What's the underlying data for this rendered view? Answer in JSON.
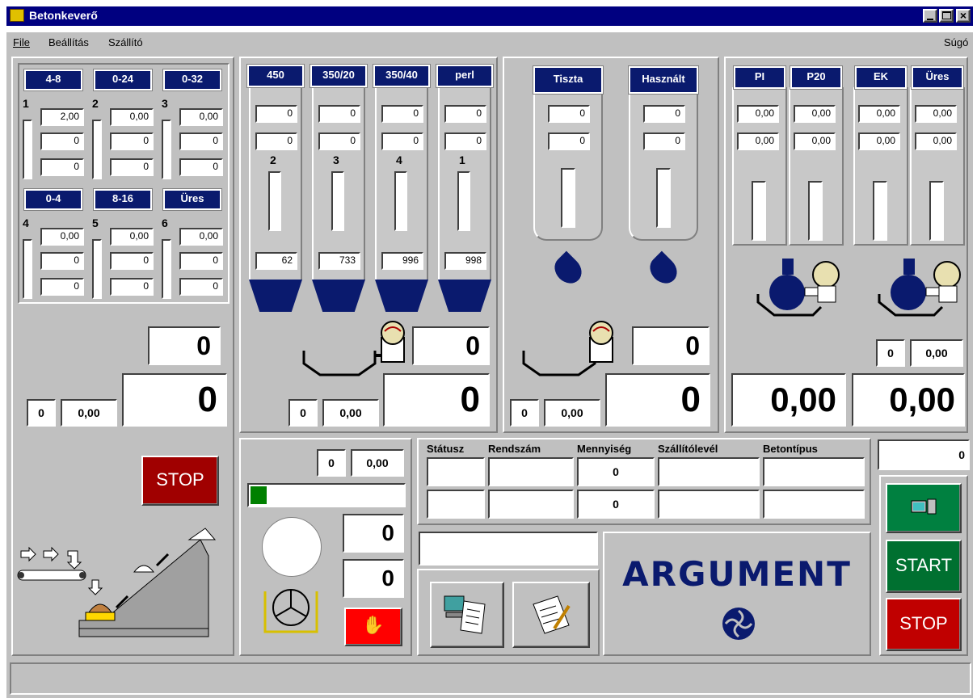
{
  "window": {
    "title": "Betonkeverő"
  },
  "menu": {
    "file": "File",
    "settings": "Beállítás",
    "supplier": "Szállító",
    "help": "Súgó"
  },
  "aggregates": [
    {
      "name": "4-8",
      "num": "1",
      "v1": "2,00",
      "v2": "0",
      "v3": "0"
    },
    {
      "name": "0-24",
      "num": "2",
      "v1": "0,00",
      "v2": "0",
      "v3": "0"
    },
    {
      "name": "0-32",
      "num": "3",
      "v1": "0,00",
      "v2": "0",
      "v3": "0"
    },
    {
      "name": "0-4",
      "num": "4",
      "v1": "0,00",
      "v2": "0",
      "v3": "0"
    },
    {
      "name": "8-16",
      "num": "5",
      "v1": "0,00",
      "v2": "0",
      "v3": "0"
    },
    {
      "name": "Üres",
      "num": "6",
      "v1": "0,00",
      "v2": "0",
      "v3": "0"
    }
  ],
  "agg_panel": {
    "scale": "0",
    "total": "0",
    "small_count": "0",
    "small_val": "0,00",
    "stop": "STOP"
  },
  "cement": [
    {
      "name": "450",
      "v1": "0",
      "v2": "0",
      "num": "2",
      "level": "62"
    },
    {
      "name": "350/20",
      "v1": "0",
      "v2": "0",
      "num": "3",
      "level": "733"
    },
    {
      "name": "350/40",
      "v1": "0",
      "v2": "0",
      "num": "4",
      "level": "996"
    },
    {
      "name": "perl",
      "v1": "0",
      "v2": "0",
      "num": "1",
      "level": "998"
    }
  ],
  "cement_panel": {
    "scale": "0",
    "total": "0",
    "small_count": "0",
    "small_val": "0,00"
  },
  "water": [
    {
      "name": "Tiszta",
      "v1": "0",
      "v2": "0"
    },
    {
      "name": "Használt",
      "v1": "0",
      "v2": "0"
    }
  ],
  "water_panel": {
    "scale": "0",
    "total": "0",
    "small_count": "0",
    "small_val": "0,00"
  },
  "additives": [
    {
      "name": "PI",
      "v1": "0,00",
      "v2": "0,00"
    },
    {
      "name": "P20",
      "v1": "0,00",
      "v2": "0,00"
    },
    {
      "name": "EK",
      "v1": "0,00",
      "v2": "0,00"
    },
    {
      "name": "Üres",
      "v1": "0,00",
      "v2": "0,00"
    }
  ],
  "additive_panel": {
    "small_count": "0",
    "small_val": "0,00",
    "total1": "0,00",
    "total2": "0,00"
  },
  "mixer": {
    "count": "0",
    "val": "0,00",
    "progress": 0.06,
    "f1": "0",
    "f2": "0"
  },
  "table": {
    "headers": [
      "Státusz",
      "Rendszám",
      "Mennyiség",
      "Szállítólevél",
      "Betontípus"
    ],
    "rows": [
      [
        "",
        "",
        "0",
        "",
        ""
      ],
      [
        "",
        "",
        "0",
        "",
        ""
      ]
    ]
  },
  "right": {
    "counter": "0",
    "start": "START",
    "stop": "STOP"
  },
  "brand": {
    "name": "ARGUMENT"
  },
  "colors": {
    "navy": "#0a1a6e",
    "title_bar": "#000080",
    "stop_red": "#a00000",
    "start_green": "#007030",
    "alarm_red": "#ff0000"
  }
}
